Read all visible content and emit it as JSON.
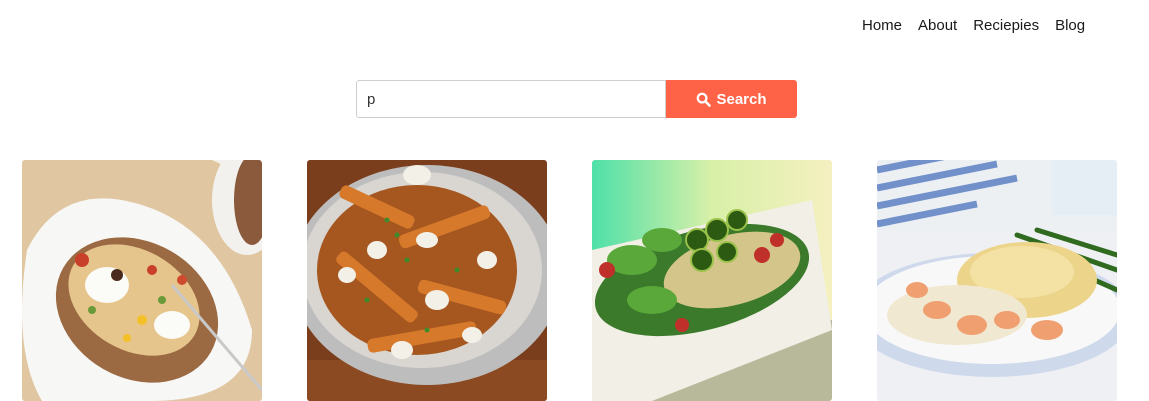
{
  "nav": {
    "items": [
      {
        "label": "Home"
      },
      {
        "label": "About"
      },
      {
        "label": "Reciepies"
      },
      {
        "label": "Blog"
      }
    ]
  },
  "search": {
    "value": "p",
    "placeholder": "",
    "button_label": "Search",
    "button_color": "#ff6347",
    "icon": "search-icon"
  },
  "results": [
    {
      "image": "loaded-baked-potato-photo"
    },
    {
      "image": "poutine-fries-photo"
    },
    {
      "image": "jalapeno-salad-plate-photo"
    },
    {
      "image": "shrimp-fish-pie-photo"
    }
  ]
}
